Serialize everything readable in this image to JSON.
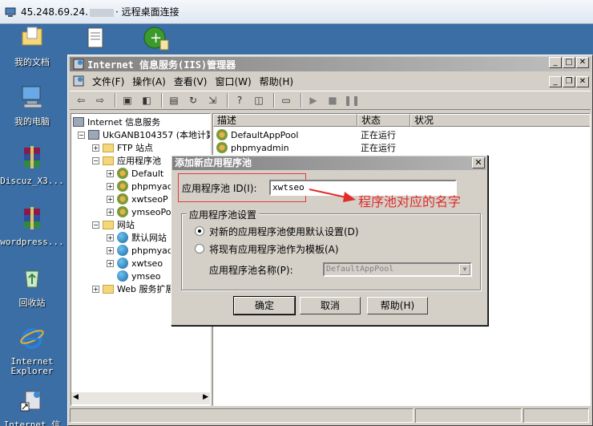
{
  "rdp": {
    "title_prefix": "45.248.69.24.",
    "title_suffix": "· 远程桌面连接"
  },
  "desktop": {
    "icons": [
      {
        "label": "我的文档",
        "icon": "my-documents-icon"
      },
      {
        "label": "我的电脑",
        "icon": "my-computer-icon"
      },
      {
        "label": "Discuz_X3...",
        "icon": "winrar-archive-icon"
      },
      {
        "label": "wordpress...",
        "icon": "winrar-archive-icon"
      },
      {
        "label": "回收站",
        "icon": "recycle-bin-icon"
      },
      {
        "label": "Internet Explorer",
        "icon": "ie-icon"
      },
      {
        "label": "Internet 信",
        "icon": "iis-shortcut-icon"
      }
    ]
  },
  "window": {
    "title": "Internet 信息服务(IIS)管理器",
    "menu": [
      "文件(F)",
      "操作(A)",
      "查看(V)",
      "窗口(W)",
      "帮助(H)"
    ]
  },
  "tree": {
    "root": "Internet 信息服务",
    "computer": "UkGANB104357 (本地计算",
    "ftp": "FTP 站点",
    "app_pools": "应用程序池",
    "pools": [
      "Default",
      "phpmyad",
      "xwtseoP",
      "ymseoPo"
    ],
    "sites": "网站",
    "site_items": [
      "默认网站",
      "phpmyad",
      "xwtseo",
      "ymseo"
    ],
    "web_ext": "Web 服务扩展"
  },
  "list": {
    "columns": [
      "描述",
      "状态",
      "状况"
    ],
    "rows": [
      {
        "name": "DefaultAppPool",
        "status": "正在运行"
      },
      {
        "name": "phpmyadmin",
        "status": "正在运行"
      }
    ]
  },
  "dialog": {
    "title": "添加新应用程序池",
    "id_label": "应用程序池 ID(I):",
    "id_value": "xwtseo",
    "group_label": "应用程序池设置",
    "radio_default": "对新的应用程序池使用默认设置(D)",
    "radio_template": "将现有应用程序池作为模板(A)",
    "pool_name_label": "应用程序池名称(P):",
    "pool_name_value": "DefaultAppPool",
    "ok": "确定",
    "cancel": "取消",
    "help": "帮助(H)"
  },
  "annotation": {
    "text": "程序池对应的名字",
    "color": "#e32b2b"
  }
}
